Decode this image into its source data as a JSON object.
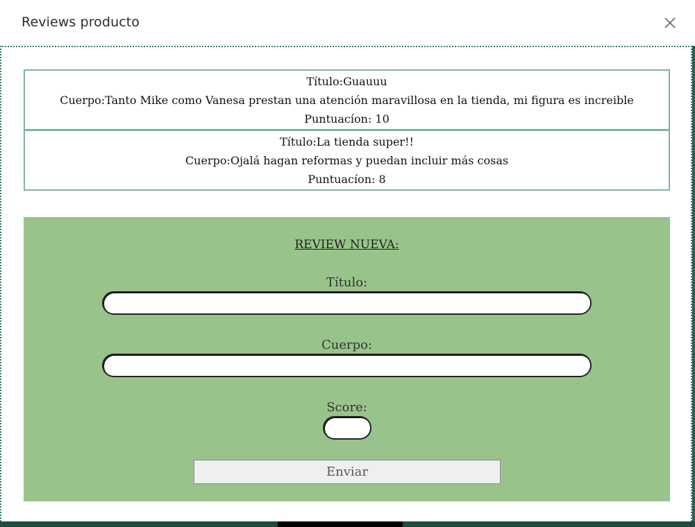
{
  "window": {
    "title": "Reviews producto"
  },
  "reviews": [
    {
      "title_label": "Título:",
      "title": "Guauuu",
      "body_label": "Cuerpo:",
      "body": "Tanto Mike como Vanesa prestan una atención maravillosa en la tienda, mi figura es increible",
      "score_label": "Puntuacíon:",
      "score": "10"
    },
    {
      "title_label": "Título:",
      "title": "La tienda super!!",
      "body_label": "Cuerpo:",
      "body": "Ojalá hagan reformas y puedan incluir más cosas",
      "score_label": "Puntuacíon:",
      "score": "8"
    }
  ],
  "form": {
    "heading": "REVIEW NUEVA:",
    "title_label": "Título:",
    "title_value": "",
    "body_label": "Cuerpo:",
    "body_value": "",
    "score_label": "Score:",
    "score_value": "",
    "submit_label": "Enviar"
  },
  "colors": {
    "panel_bg": "#98c48c",
    "review_border": "#7fb3a7",
    "dotted_border": "#2e7d6d"
  }
}
